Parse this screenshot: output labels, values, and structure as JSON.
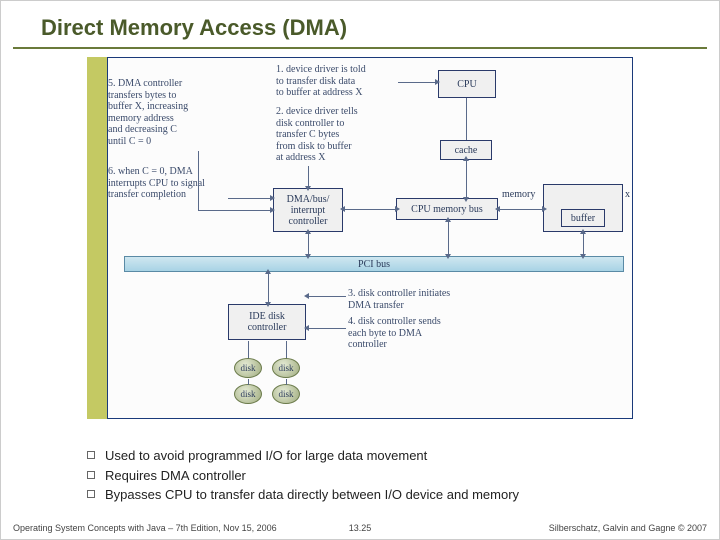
{
  "title": "Direct Memory Access (DMA)",
  "diagram": {
    "steps": {
      "s1": "1. device driver is told\nto transfer disk data\nto buffer at address X",
      "s2": "2. device driver tells\ndisk controller to\ntransfer C bytes\nfrom disk to buffer\nat address X",
      "s3": "3. disk controller initiates\nDMA transfer",
      "s4": "4. disk controller sends\neach byte to DMA\ncontroller",
      "s5": "5. DMA controller\ntransfers bytes to\nbuffer X, increasing\nmemory address\nand decreasing C\nuntil C = 0",
      "s6": "6. when C = 0, DMA\ninterrupts CPU to signal\ntransfer completion"
    },
    "boxes": {
      "cpu": "CPU",
      "cache": "cache",
      "dma": "DMA/bus/\ninterrupt\ncontroller",
      "bus": "CPU memory bus",
      "memory": "memory",
      "buffer": "buffer",
      "x": "x",
      "pci": "PCI bus",
      "ide": "IDE disk\ncontroller",
      "disk": "disk"
    }
  },
  "bullets": [
    "Used to avoid programmed I/O for large data movement",
    "Requires DMA controller",
    "Bypasses CPU to transfer data directly between I/O device and memory"
  ],
  "footer": {
    "left": "Operating System Concepts with Java – 7th Edition, Nov 15, 2006",
    "center": "13.25",
    "right": "Silberschatz, Galvin and Gagne © 2007"
  }
}
